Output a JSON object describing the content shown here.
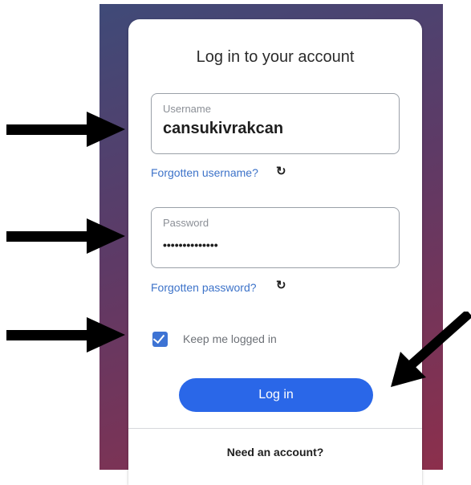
{
  "form": {
    "title": "Log in to your account",
    "username": {
      "label": "Username",
      "value": "cansukivrakcan"
    },
    "password": {
      "label": "Password",
      "value": "••••••••••••••"
    },
    "forgot_username": "Forgotten username?",
    "forgot_password": "Forgotten password?",
    "refresh_glyph": "↻",
    "keep_logged_in": {
      "label": "Keep me logged in",
      "checked": true
    },
    "login_button": "Log in",
    "need_account": "Need an account?"
  },
  "annotations": {
    "arrow_color": "#000000",
    "arrow_count": 4
  },
  "colors": {
    "accent": "#2a67e8",
    "link": "#3d73c9",
    "checkbox": "#3d73d4",
    "gradient_top": "#3f4a78",
    "gradient_bottom": "#8c2f4c"
  }
}
